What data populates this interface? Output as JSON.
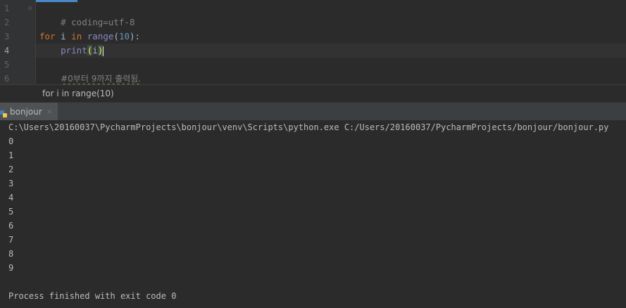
{
  "editor": {
    "line_numbers": [
      "1",
      "2",
      "3",
      "4",
      "5",
      "6"
    ],
    "lines": {
      "l1": "# coding=utf-8",
      "l3_kw_for": "for",
      "l3_var": "i",
      "l3_kw_in": "in",
      "l3_builtin": "range",
      "l3_open": "(",
      "l3_num": "10",
      "l3_close": "):",
      "l4_builtin": "print",
      "l4_open": "(",
      "l4_arg": "i",
      "l4_close": ")",
      "l5": "#0부터 9까지 출력됨."
    }
  },
  "breadcrumb": {
    "text": "for i in range(10)"
  },
  "run_panel": {
    "tab_label": "bonjour",
    "close_glyph": "×"
  },
  "console": {
    "command": "C:\\Users\\20160037\\PycharmProjects\\bonjour\\venv\\Scripts\\python.exe C:/Users/20160037/PycharmProjects/bonjour/bonjour.py",
    "outputs": [
      "0",
      "1",
      "2",
      "3",
      "4",
      "5",
      "6",
      "7",
      "8",
      "9"
    ],
    "finished": "Process finished with exit code 0"
  },
  "colors": {
    "background": "#2b2b2b",
    "keyword": "#cc7832",
    "builtin": "#8888c6",
    "number": "#6897bb",
    "comment": "#808080"
  },
  "icons": [
    "python-file-icon",
    "close-icon"
  ]
}
